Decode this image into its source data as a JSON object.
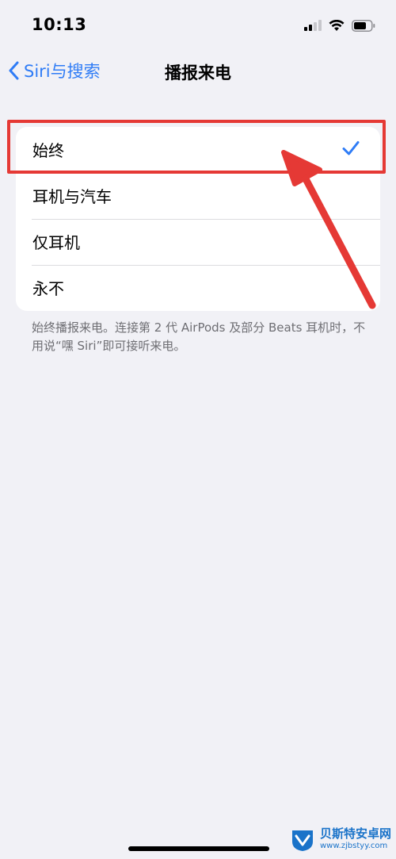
{
  "status_bar": {
    "time": "10:13",
    "icons": [
      "signal-icon",
      "wifi-icon",
      "battery-icon"
    ]
  },
  "nav": {
    "back_label": "Siri与搜索",
    "title": "播报来电"
  },
  "options": [
    {
      "label": "始终",
      "selected": true
    },
    {
      "label": "耳机与汽车",
      "selected": false
    },
    {
      "label": "仅耳机",
      "selected": false
    },
    {
      "label": "永不",
      "selected": false
    }
  ],
  "footer_note": "始终播报来电。连接第 2 代 AirPods 及部分 Beats 耳机时，不用说“嘿 Siri”即可接听来电。",
  "colors": {
    "accent": "#2f7cf6",
    "annotation": "#e53935",
    "background": "#f1f1f6"
  },
  "watermark": {
    "name": "贝斯特安卓网",
    "url": "www.zjbstyy.com"
  }
}
